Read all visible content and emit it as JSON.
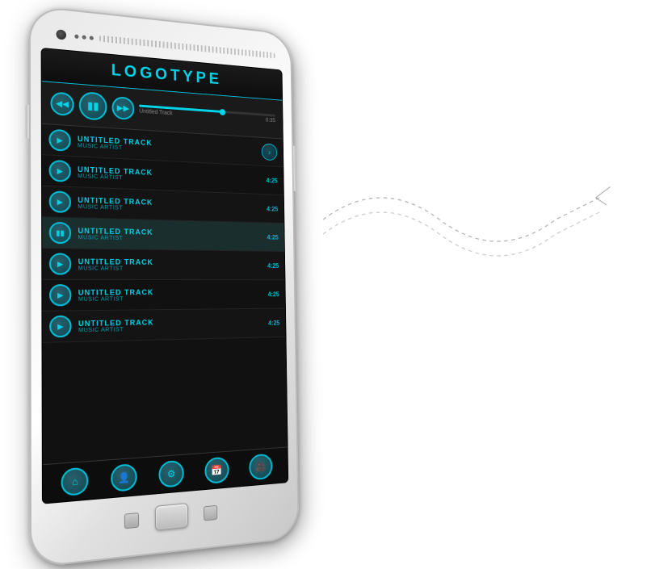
{
  "app": {
    "logo": "LOGOTYPE"
  },
  "player": {
    "track_name": "Untitled Track",
    "duration": "0:35",
    "rewind_icon": "⏮",
    "pause_icon": "⏸",
    "forward_icon": "⏭",
    "progress_percent": 60
  },
  "tracks": [
    {
      "id": 1,
      "title": "UNTITLED TRACK",
      "artist": "MUSIC ARTIST",
      "duration": "",
      "active": false
    },
    {
      "id": 2,
      "title": "UNTITLED TRACK",
      "artist": "MUSIC ARTIST",
      "duration": "4:25",
      "active": false
    },
    {
      "id": 3,
      "title": "UNTITLED TRACK",
      "artist": "MUSIC ARTIST",
      "duration": "4:25",
      "active": false
    },
    {
      "id": 4,
      "title": "UNTITLED TRACK",
      "artist": "MUSIC ARTIST",
      "duration": "4:25",
      "active": true
    },
    {
      "id": 5,
      "title": "UNTITLED TRACK",
      "artist": "MUSIC ARTIST",
      "duration": "4:25",
      "active": false
    },
    {
      "id": 6,
      "title": "UNTITLED TRACK",
      "artist": "MUSIC ARTIST",
      "duration": "4:25",
      "active": false
    },
    {
      "id": 7,
      "title": "UNTITLED TRACK",
      "artist": "MUSIC ARTIST",
      "duration": "4:25",
      "active": false
    }
  ],
  "bottom_nav": {
    "home_icon": "⌂",
    "user_icon": "👤",
    "settings_icon": "⚙",
    "calendar_icon": "📅",
    "film_icon": "🎬"
  }
}
